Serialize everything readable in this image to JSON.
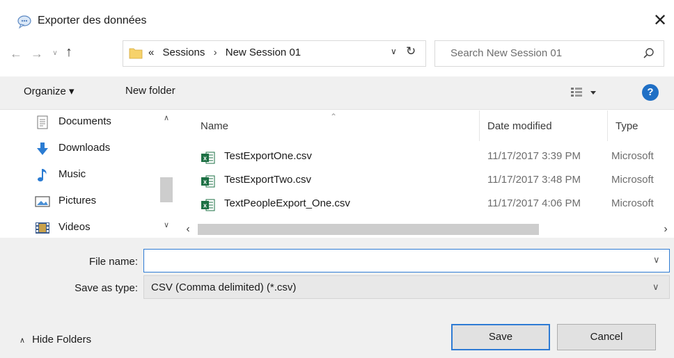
{
  "window": {
    "title": "Exporter des données",
    "close_glyph": "✕"
  },
  "address_bar": {
    "overflow_glyph": "«",
    "path": [
      "Sessions",
      "New Session 01"
    ],
    "separator": "›",
    "dropdown_glyph": "∨",
    "refresh_glyph": "↻"
  },
  "nav_buttons": {
    "back": "←",
    "forward": "→",
    "recent": "∨",
    "up": "↑"
  },
  "search": {
    "placeholder": "Search New Session 01"
  },
  "toolbar": {
    "organize_label": "Organize ▾",
    "new_folder_label": "New folder",
    "help_label": "?"
  },
  "navigation_pane": {
    "items": [
      {
        "label": "Documents",
        "icon": "documents-icon"
      },
      {
        "label": "Downloads",
        "icon": "downloads-icon"
      },
      {
        "label": "Music",
        "icon": "music-icon"
      },
      {
        "label": "Pictures",
        "icon": "pictures-icon"
      },
      {
        "label": "Videos",
        "icon": "videos-icon"
      }
    ],
    "scroll_up_glyph": "∧",
    "scroll_down_glyph": "∨"
  },
  "file_list": {
    "columns": {
      "name": "Name",
      "date_modified": "Date modified",
      "type": "Type"
    },
    "sort_glyph": "⌃",
    "files": [
      {
        "name": "TestExportOne.csv",
        "date": "11/17/2017 3:39 PM",
        "type": "Microsoft"
      },
      {
        "name": "TestExportTwo.csv",
        "date": "11/17/2017 3:48 PM",
        "type": "Microsoft"
      },
      {
        "name": "TextPeopleExport_One.csv",
        "date": "11/17/2017 4:06 PM",
        "type": "Microsoft"
      }
    ],
    "scroll_left_glyph": "‹",
    "scroll_right_glyph": "›"
  },
  "save_form": {
    "file_name_label": "File name:",
    "file_name_value": "",
    "file_name_dropdown_glyph": "∨",
    "save_as_type_label": "Save as type:",
    "save_as_type_value": "CSV (Comma delimited) (*.csv)",
    "save_as_type_dropdown_glyph": "∨"
  },
  "footer": {
    "hide_folders_glyph": "∧",
    "hide_folders_label": "Hide Folders",
    "save_label": "Save",
    "cancel_label": "Cancel"
  },
  "colors": {
    "accent": "#2e7bd4",
    "help": "#1f6fc5",
    "toolbar_bg": "#f0f0f0",
    "excel_green": "#1d7044"
  }
}
